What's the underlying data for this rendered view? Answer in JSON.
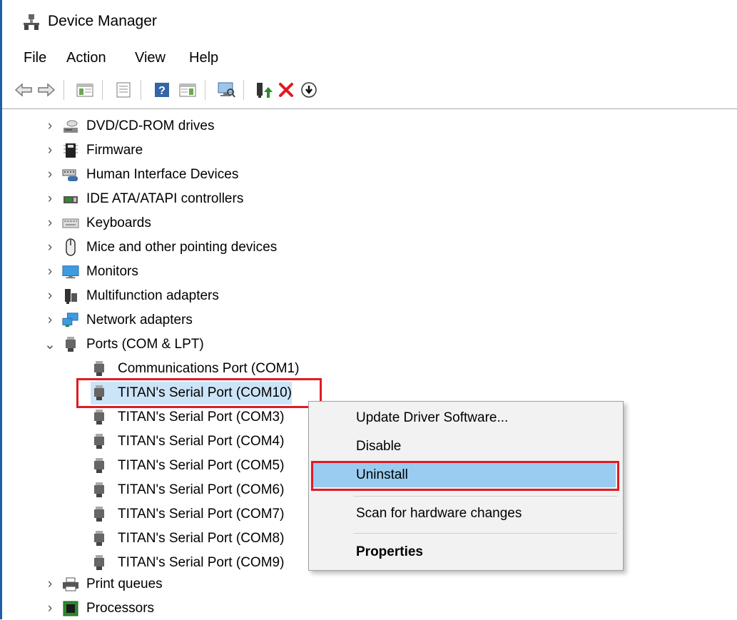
{
  "window": {
    "title": "Device Manager"
  },
  "menu": [
    "File",
    "Action",
    "View",
    "Help"
  ],
  "toolbar": {
    "buttons": [
      "back-icon",
      "forward-icon",
      "show-hide-console-tree-icon",
      "properties-icon",
      "help-icon",
      "action-pane-icon",
      "scan-hardware-icon",
      "update-driver-icon",
      "uninstall-icon",
      "download-icon"
    ]
  },
  "tree": {
    "categories": [
      {
        "label": "DVD/CD-ROM drives",
        "icon": "dvd-drive-icon",
        "expanded": false
      },
      {
        "label": "Firmware",
        "icon": "firmware-chip-icon",
        "expanded": false
      },
      {
        "label": "Human Interface Devices",
        "icon": "hid-device-icon",
        "expanded": false
      },
      {
        "label": "IDE ATA/ATAPI controllers",
        "icon": "ide-controller-icon",
        "expanded": false
      },
      {
        "label": "Keyboards",
        "icon": "keyboard-icon",
        "expanded": false
      },
      {
        "label": "Mice and other pointing devices",
        "icon": "mouse-icon",
        "expanded": false
      },
      {
        "label": "Monitors",
        "icon": "monitor-icon",
        "expanded": false
      },
      {
        "label": "Multifunction adapters",
        "icon": "multifunction-adapter-icon",
        "expanded": false
      },
      {
        "label": "Network adapters",
        "icon": "network-adapter-icon",
        "expanded": false
      },
      {
        "label": "Ports (COM & LPT)",
        "icon": "port-icon",
        "expanded": true
      },
      {
        "label": "Print queues",
        "icon": "printer-icon",
        "expanded": false
      },
      {
        "label": "Processors",
        "icon": "processor-icon",
        "expanded": false
      }
    ],
    "ports": [
      "Communications Port (COM1)",
      "TITAN's Serial Port (COM10)",
      "TITAN's Serial Port (COM3)",
      "TITAN's Serial Port (COM4)",
      "TITAN's Serial Port (COM5)",
      "TITAN's Serial Port (COM6)",
      "TITAN's Serial Port (COM7)",
      "TITAN's Serial Port (COM8)",
      "TITAN's Serial Port (COM9)"
    ],
    "selected_port": "TITAN's Serial Port (COM10)"
  },
  "context_menu": {
    "items": [
      {
        "label": "Update Driver Software...",
        "bold": false,
        "highlighted": false
      },
      {
        "label": "Disable",
        "bold": false,
        "highlighted": false
      },
      {
        "label": "Uninstall",
        "bold": false,
        "highlighted": true
      },
      {
        "label": "Scan for hardware changes",
        "bold": false,
        "highlighted": false
      },
      {
        "label": "Properties",
        "bold": true,
        "highlighted": false
      }
    ]
  },
  "colors": {
    "highlight": "#99ccf0",
    "annotation_red": "#e01b24",
    "uninstall_red": "#e01b24",
    "update_green": "#2d8a2d"
  }
}
